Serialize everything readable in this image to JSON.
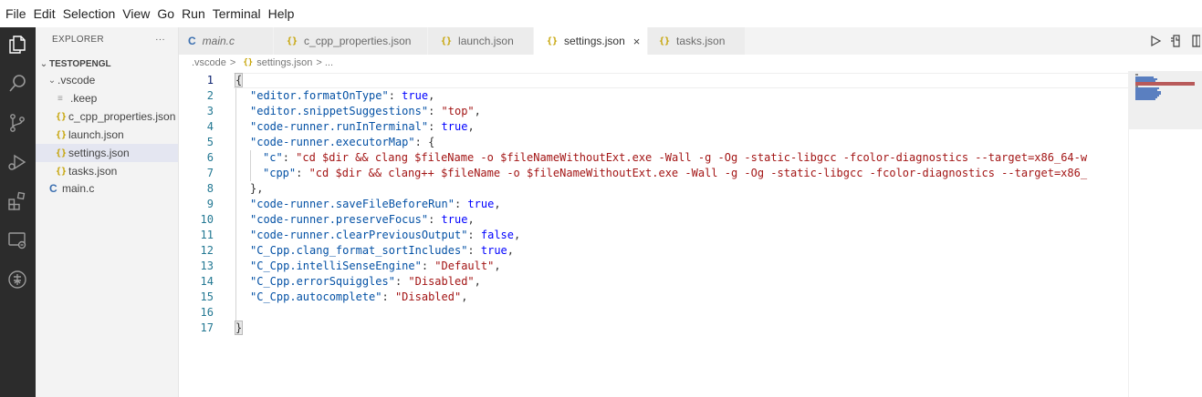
{
  "menu": [
    "File",
    "Edit",
    "Selection",
    "View",
    "Go",
    "Run",
    "Terminal",
    "Help"
  ],
  "activity_icons": [
    "explorer-icon",
    "search-icon",
    "source-control-icon",
    "run-debug-icon",
    "extensions-icon",
    "remote-explorer-icon",
    "accounts-globe-icon"
  ],
  "sidebar": {
    "title": "EXPLORER",
    "more": "···",
    "folder": "TESTOPENGL",
    "items": [
      {
        "label": ".vscode",
        "kind": "folder"
      },
      {
        "label": ".keep",
        "kind": "file"
      },
      {
        "label": "c_cpp_properties.json",
        "kind": "json"
      },
      {
        "label": "launch.json",
        "kind": "json"
      },
      {
        "label": "settings.json",
        "kind": "json"
      },
      {
        "label": "tasks.json",
        "kind": "json"
      },
      {
        "label": "main.c",
        "kind": "c"
      }
    ],
    "json_glyph": "{}",
    "c_glyph": "C",
    "file_glyph": "≡"
  },
  "tabs": [
    {
      "label": "main.c",
      "kind": "c"
    },
    {
      "label": "c_cpp_properties.json",
      "kind": "json"
    },
    {
      "label": "launch.json",
      "kind": "json"
    },
    {
      "label": "settings.json",
      "kind": "json",
      "active": true
    },
    {
      "label": "tasks.json",
      "kind": "json"
    }
  ],
  "tab_close": "×",
  "breadcrumb": {
    "folder": ".vscode",
    "sep": ">",
    "file": "settings.json",
    "tail": "> ..."
  },
  "editor": {
    "line_numbers": [
      "1",
      "2",
      "3",
      "4",
      "5",
      "6",
      "7",
      "8",
      "9",
      "10",
      "11",
      "12",
      "13",
      "14",
      "15",
      "16",
      "17"
    ],
    "lines": [
      {
        "open_brace": "{"
      },
      {
        "key": "\"editor.formatOnType\"",
        "sep": ": ",
        "bool": "true",
        "end": ","
      },
      {
        "key": "\"editor.snippetSuggestions\"",
        "sep": ": ",
        "str": "\"top\"",
        "end": ","
      },
      {
        "key": "\"code-runner.runInTerminal\"",
        "sep": ": ",
        "bool": "true",
        "end": ","
      },
      {
        "key": "\"code-runner.executorMap\"",
        "sep": ": ",
        "punct": "{"
      },
      {
        "key": "\"c\"",
        "sep": ": ",
        "str": "\"cd $dir && clang $fileName -o $fileNameWithoutExt.exe -Wall -g -Og -static-libgcc -fcolor-diagnostics --target=x86_64-w"
      },
      {
        "key": "\"cpp\"",
        "sep": ": ",
        "str": "\"cd $dir && clang++ $fileName -o $fileNameWithoutExt.exe -Wall -g -Og -static-libgcc -fcolor-diagnostics --target=x86_"
      },
      {
        "punct": "},"
      },
      {
        "key": "\"code-runner.saveFileBeforeRun\"",
        "sep": ": ",
        "bool": "true",
        "end": ","
      },
      {
        "key": "\"code-runner.preserveFocus\"",
        "sep": ": ",
        "bool": "true",
        "end": ","
      },
      {
        "key": "\"code-runner.clearPreviousOutput\"",
        "sep": ": ",
        "bool": "false",
        "end": ","
      },
      {
        "key": "\"C_Cpp.clang_format_sortIncludes\"",
        "sep": ": ",
        "bool": "true",
        "end": ","
      },
      {
        "key": "\"C_Cpp.intelliSenseEngine\"",
        "sep": ": ",
        "str": "\"Default\"",
        "end": ","
      },
      {
        "key": "\"C_Cpp.errorSquiggles\"",
        "sep": ": ",
        "str": "\"Disabled\"",
        "end": ","
      },
      {
        "key": "\"C_Cpp.autocomplete\"",
        "sep": ": ",
        "str": "\"Disabled\"",
        "end": ","
      },
      {},
      {
        "close_brace": "}"
      }
    ]
  },
  "colors": {
    "key": "#0451a5",
    "string": "#a31515",
    "boolean": "#0000ff",
    "line_number": "#237893",
    "activity_bar": "#2c2c2c"
  }
}
